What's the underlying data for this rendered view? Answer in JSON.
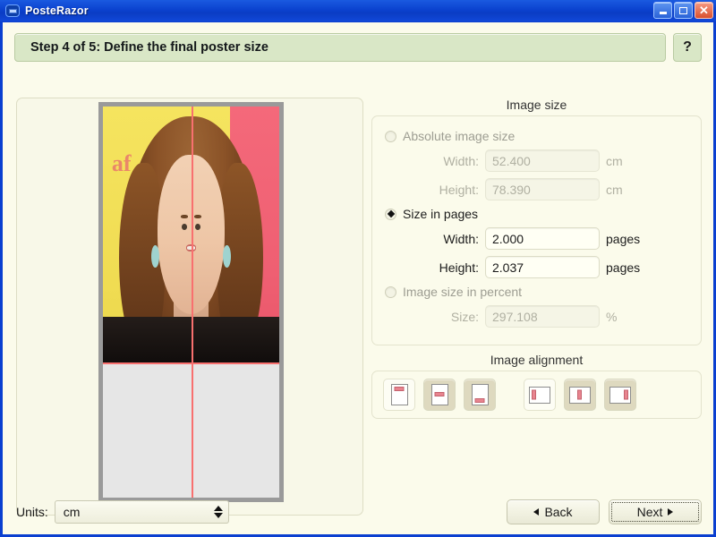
{
  "window": {
    "title": "PosteRazor",
    "icon": "app-icon",
    "controls": {
      "minimize": "minimize",
      "maximize": "maximize",
      "close": "close"
    }
  },
  "header": {
    "step_text": "Step 4 of 5: Define the final poster size",
    "help_label": "?"
  },
  "preview": {
    "label": "poster-preview",
    "photo_text": "af"
  },
  "image_size": {
    "group_title": "Image size",
    "options": [
      {
        "label": "Absolute image size",
        "selected": false,
        "enabled": false
      },
      {
        "label": "Size in pages",
        "selected": true,
        "enabled": true
      },
      {
        "label": "Image size in percent",
        "selected": false,
        "enabled": false
      }
    ],
    "absolute": {
      "width_label": "Width:",
      "width_value": "52.400",
      "width_unit": "cm",
      "height_label": "Height:",
      "height_value": "78.390",
      "height_unit": "cm"
    },
    "pages": {
      "width_label": "Width:",
      "width_value": "2.000",
      "width_unit": "pages",
      "height_label": "Height:",
      "height_value": "2.037",
      "height_unit": "pages"
    },
    "percent": {
      "size_label": "Size:",
      "size_value": "297.108",
      "size_unit": "%"
    }
  },
  "image_alignment": {
    "group_title": "Image alignment",
    "buttons": [
      {
        "name": "align-top",
        "selected": true
      },
      {
        "name": "align-middle",
        "selected": false
      },
      {
        "name": "align-bottom",
        "selected": false
      },
      {
        "name": "align-left",
        "selected": true
      },
      {
        "name": "align-center",
        "selected": false
      },
      {
        "name": "align-right",
        "selected": false
      }
    ]
  },
  "footer": {
    "units_label": "Units:",
    "units_value": "cm",
    "back_label": "Back",
    "next_label": "Next"
  },
  "colors": {
    "titlebar": "#0b42cf",
    "banner": "#d9e7c6",
    "client": "#fbfbeb",
    "guide": "#f8706f",
    "frame": "#9a9a9a"
  }
}
